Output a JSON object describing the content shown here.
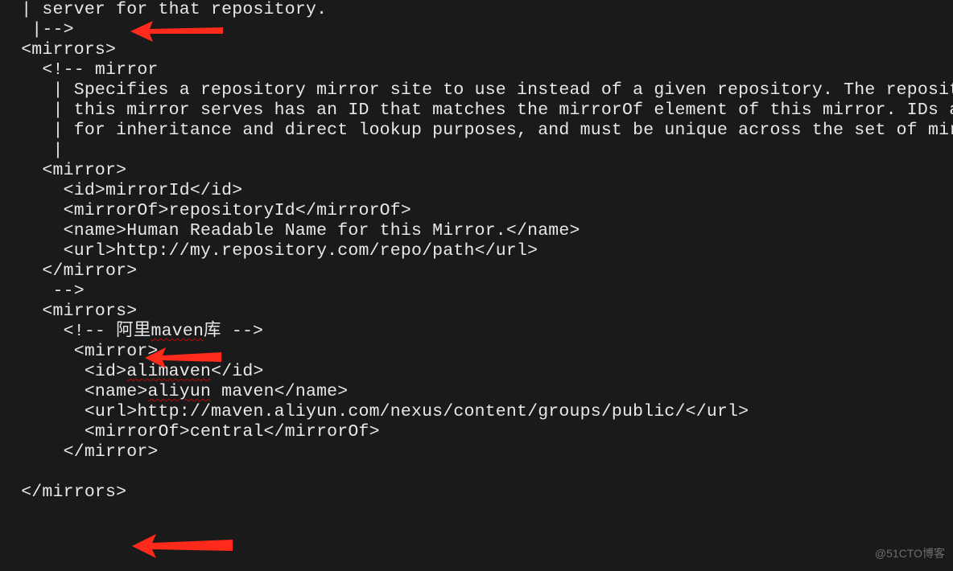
{
  "code": {
    "l00": "  | server for that repository.",
    "l01": "   |-->",
    "l02": "  <mirrors>",
    "l03": "    <!-- mirror",
    "l04": "     | Specifies a repository mirror site to use instead of a given repository. The repository that",
    "l05": "     | this mirror serves has an ID that matches the mirrorOf element of this mirror. IDs are used",
    "l06": "     | for inheritance and direct lookup purposes, and must be unique across the set of mirrors.",
    "l07": "     |",
    "l08": "    <mirror>",
    "l09": "      <id>mirrorId</id>",
    "l10": "      <mirrorOf>repositoryId</mirrorOf>",
    "l11": "      <name>Human Readable Name for this Mirror.</name>",
    "l12": "      <url>http://my.repository.com/repo/path</url>",
    "l13": "    </mirror>",
    "l14": "     -->",
    "l15": "    <mirrors>",
    "l16_a": "      <!-- 阿里",
    "l16_b": "maven",
    "l16_c": "库 -->",
    "l17": "       <mirror>",
    "l18_a": "        <id>",
    "l18_b": "alimaven",
    "l18_c": "</id>",
    "l19_a": "        <name>",
    "l19_b": "aliyun",
    "l19_c": " maven</name>",
    "l20": "        <url>http://maven.aliyun.com/nexus/content/groups/public/</url>",
    "l21": "        <mirrorOf>central</mirrorOf>",
    "l22": "      </mirror>",
    "l23": "",
    "l24": "  </mirrors>"
  },
  "watermark": "@51CTO博客",
  "arrows": {
    "color": "#ff2a1b"
  }
}
